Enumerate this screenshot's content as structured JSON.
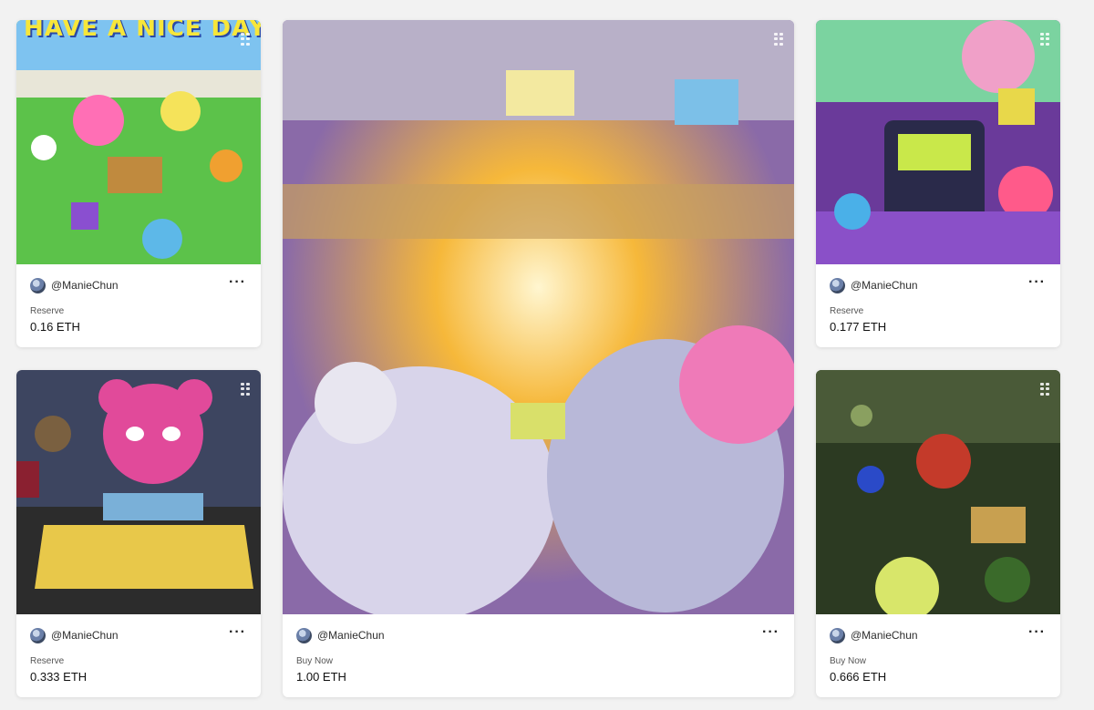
{
  "cards": [
    {
      "creator": "@ManieChun",
      "status": "Reserve",
      "price": "0.16 ETH",
      "art_title": "HAVE A NICE DAY"
    },
    {
      "creator": "@ManieChun",
      "status": "Reserve",
      "price": "0.333 ETH"
    },
    {
      "creator": "@ManieChun",
      "status": "Buy Now",
      "price": "1.00 ETH"
    },
    {
      "creator": "@ManieChun",
      "status": "Reserve",
      "price": "0.177 ETH"
    },
    {
      "creator": "@ManieChun",
      "status": "Buy Now",
      "price": "0.666 ETH"
    }
  ],
  "icons": {
    "more": "more-horizontal-icon",
    "drag": "drag-handle-icon",
    "avatar": "avatar"
  },
  "colors": {
    "background": "#f2f2f2",
    "card": "#ffffff",
    "text": "#111111"
  }
}
